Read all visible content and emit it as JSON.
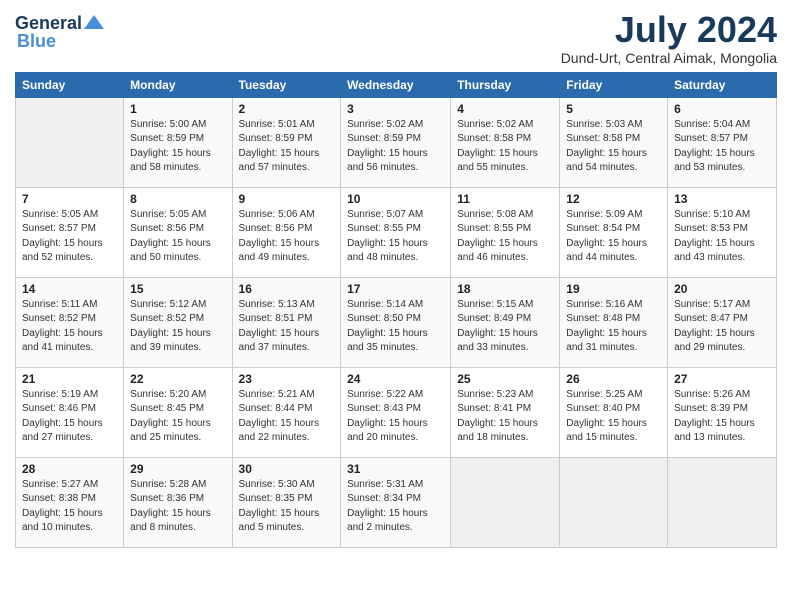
{
  "header": {
    "logo_general": "General",
    "logo_blue": "Blue",
    "title": "July 2024",
    "location": "Dund-Urt, Central Aimak, Mongolia"
  },
  "weekdays": [
    "Sunday",
    "Monday",
    "Tuesday",
    "Wednesday",
    "Thursday",
    "Friday",
    "Saturday"
  ],
  "weeks": [
    [
      {
        "day": "",
        "empty": true
      },
      {
        "day": "1",
        "sunrise": "5:00 AM",
        "sunset": "8:59 PM",
        "daylight": "15 hours and 58 minutes."
      },
      {
        "day": "2",
        "sunrise": "5:01 AM",
        "sunset": "8:59 PM",
        "daylight": "15 hours and 57 minutes."
      },
      {
        "day": "3",
        "sunrise": "5:02 AM",
        "sunset": "8:59 PM",
        "daylight": "15 hours and 56 minutes."
      },
      {
        "day": "4",
        "sunrise": "5:02 AM",
        "sunset": "8:58 PM",
        "daylight": "15 hours and 55 minutes."
      },
      {
        "day": "5",
        "sunrise": "5:03 AM",
        "sunset": "8:58 PM",
        "daylight": "15 hours and 54 minutes."
      },
      {
        "day": "6",
        "sunrise": "5:04 AM",
        "sunset": "8:57 PM",
        "daylight": "15 hours and 53 minutes."
      }
    ],
    [
      {
        "day": "7",
        "sunrise": "5:05 AM",
        "sunset": "8:57 PM",
        "daylight": "15 hours and 52 minutes."
      },
      {
        "day": "8",
        "sunrise": "5:05 AM",
        "sunset": "8:56 PM",
        "daylight": "15 hours and 50 minutes."
      },
      {
        "day": "9",
        "sunrise": "5:06 AM",
        "sunset": "8:56 PM",
        "daylight": "15 hours and 49 minutes."
      },
      {
        "day": "10",
        "sunrise": "5:07 AM",
        "sunset": "8:55 PM",
        "daylight": "15 hours and 48 minutes."
      },
      {
        "day": "11",
        "sunrise": "5:08 AM",
        "sunset": "8:55 PM",
        "daylight": "15 hours and 46 minutes."
      },
      {
        "day": "12",
        "sunrise": "5:09 AM",
        "sunset": "8:54 PM",
        "daylight": "15 hours and 44 minutes."
      },
      {
        "day": "13",
        "sunrise": "5:10 AM",
        "sunset": "8:53 PM",
        "daylight": "15 hours and 43 minutes."
      }
    ],
    [
      {
        "day": "14",
        "sunrise": "5:11 AM",
        "sunset": "8:52 PM",
        "daylight": "15 hours and 41 minutes."
      },
      {
        "day": "15",
        "sunrise": "5:12 AM",
        "sunset": "8:52 PM",
        "daylight": "15 hours and 39 minutes."
      },
      {
        "day": "16",
        "sunrise": "5:13 AM",
        "sunset": "8:51 PM",
        "daylight": "15 hours and 37 minutes."
      },
      {
        "day": "17",
        "sunrise": "5:14 AM",
        "sunset": "8:50 PM",
        "daylight": "15 hours and 35 minutes."
      },
      {
        "day": "18",
        "sunrise": "5:15 AM",
        "sunset": "8:49 PM",
        "daylight": "15 hours and 33 minutes."
      },
      {
        "day": "19",
        "sunrise": "5:16 AM",
        "sunset": "8:48 PM",
        "daylight": "15 hours and 31 minutes."
      },
      {
        "day": "20",
        "sunrise": "5:17 AM",
        "sunset": "8:47 PM",
        "daylight": "15 hours and 29 minutes."
      }
    ],
    [
      {
        "day": "21",
        "sunrise": "5:19 AM",
        "sunset": "8:46 PM",
        "daylight": "15 hours and 27 minutes."
      },
      {
        "day": "22",
        "sunrise": "5:20 AM",
        "sunset": "8:45 PM",
        "daylight": "15 hours and 25 minutes."
      },
      {
        "day": "23",
        "sunrise": "5:21 AM",
        "sunset": "8:44 PM",
        "daylight": "15 hours and 22 minutes."
      },
      {
        "day": "24",
        "sunrise": "5:22 AM",
        "sunset": "8:43 PM",
        "daylight": "15 hours and 20 minutes."
      },
      {
        "day": "25",
        "sunrise": "5:23 AM",
        "sunset": "8:41 PM",
        "daylight": "15 hours and 18 minutes."
      },
      {
        "day": "26",
        "sunrise": "5:25 AM",
        "sunset": "8:40 PM",
        "daylight": "15 hours and 15 minutes."
      },
      {
        "day": "27",
        "sunrise": "5:26 AM",
        "sunset": "8:39 PM",
        "daylight": "15 hours and 13 minutes."
      }
    ],
    [
      {
        "day": "28",
        "sunrise": "5:27 AM",
        "sunset": "8:38 PM",
        "daylight": "15 hours and 10 minutes."
      },
      {
        "day": "29",
        "sunrise": "5:28 AM",
        "sunset": "8:36 PM",
        "daylight": "15 hours and 8 minutes."
      },
      {
        "day": "30",
        "sunrise": "5:30 AM",
        "sunset": "8:35 PM",
        "daylight": "15 hours and 5 minutes."
      },
      {
        "day": "31",
        "sunrise": "5:31 AM",
        "sunset": "8:34 PM",
        "daylight": "15 hours and 2 minutes."
      },
      {
        "day": "",
        "empty": true
      },
      {
        "day": "",
        "empty": true
      },
      {
        "day": "",
        "empty": true
      }
    ]
  ]
}
